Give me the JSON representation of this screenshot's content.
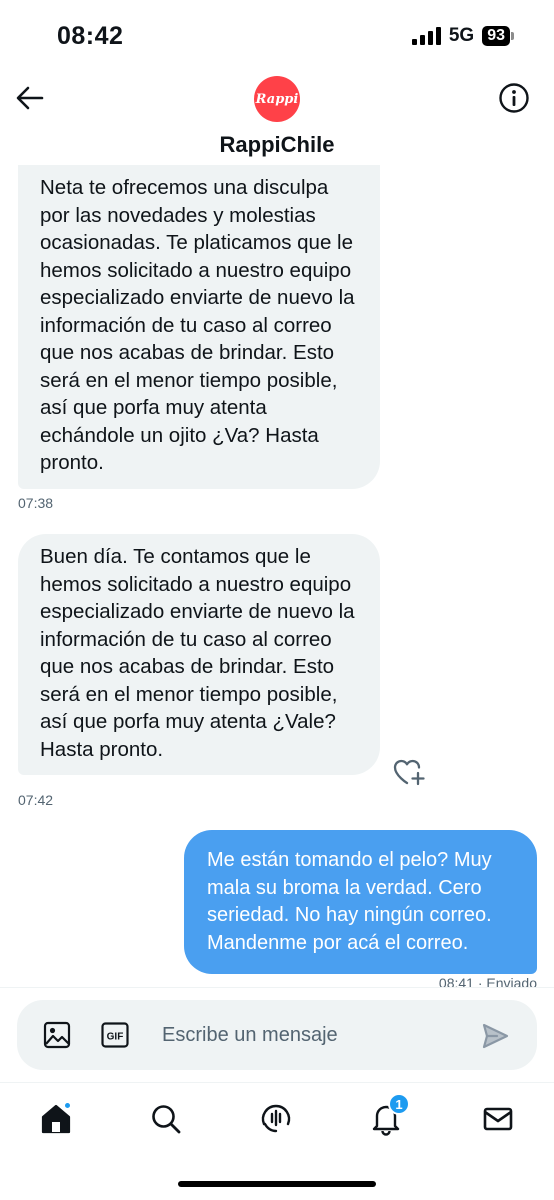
{
  "status_bar": {
    "time": "08:42",
    "network": "5G",
    "battery": "93"
  },
  "header": {
    "avatar_text": "Rappi",
    "contact_name": "RappiChile"
  },
  "messages": [
    {
      "direction": "incoming",
      "text": "Neta te ofrecemos una disculpa por las novedades y molestias ocasionadas. Te platicamos que le hemos solicitado a nuestro equipo especializado enviarte de nuevo la información de tu caso al correo que nos acabas de brindar. Esto será en el menor tiempo posible, así que porfa muy atenta echándole un ojito ¿Va? Hasta pronto.",
      "time": "07:38"
    },
    {
      "direction": "incoming",
      "text": "Buen día. Te contamos que le hemos solicitado a nuestro equipo especializado enviarte de nuevo la información de tu caso al correo que nos acabas de brindar. Esto será en el menor tiempo posible, así que porfa muy atenta ¿Vale? Hasta pronto.",
      "time": "07:42"
    },
    {
      "direction": "outgoing",
      "text": "Me están tomando el pelo? Muy mala su broma la verdad. Cero seriedad. No hay ningún correo. Mandenme por acá el correo.",
      "time": "08:41 · Enviado"
    }
  ],
  "composer": {
    "placeholder": "Escribe un mensaje",
    "gif_label": "GIF"
  },
  "tabbar": {
    "notifications_badge": "1"
  },
  "colors": {
    "accent": "#1d9bf0",
    "outgoing_bubble": "#4a9ff0",
    "incoming_bubble": "#eff3f4",
    "brand": "#ff4148"
  }
}
